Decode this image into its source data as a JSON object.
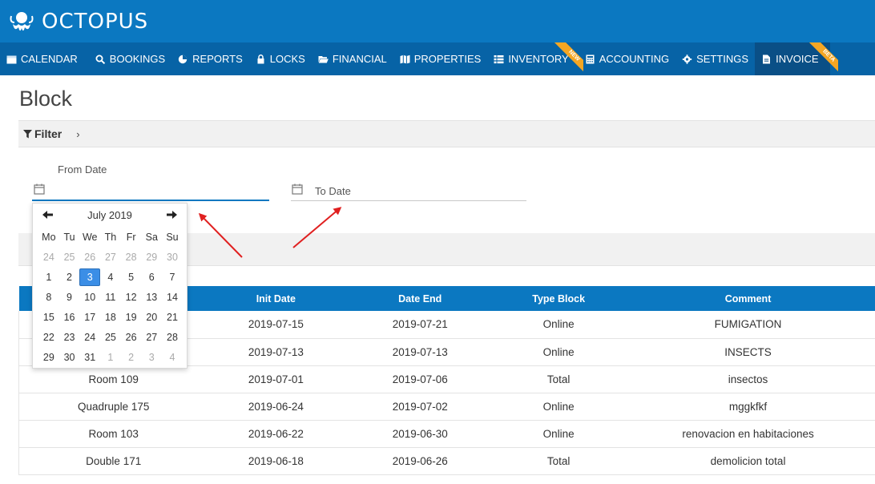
{
  "brand": {
    "name": "OCTOPUS"
  },
  "nav": {
    "items": [
      {
        "label": "CALENDAR",
        "icon": "calendar-icon"
      },
      {
        "label": "BOOKINGS",
        "icon": "search-icon"
      },
      {
        "label": "REPORTS",
        "icon": "pie-chart-icon"
      },
      {
        "label": "LOCKS",
        "icon": "lock-icon"
      },
      {
        "label": "FINANCIAL",
        "icon": "folder-open-icon"
      },
      {
        "label": "PROPERTIES",
        "icon": "map-icon"
      },
      {
        "label": "INVENTORY",
        "icon": "list-icon",
        "ribbon": "NEW"
      },
      {
        "label": "ACCOUNTING",
        "icon": "calculator-icon"
      },
      {
        "label": "SETTINGS",
        "icon": "gear-icon"
      },
      {
        "label": "INVOICE",
        "icon": "file-icon",
        "ribbon": "BETA",
        "active": true
      }
    ]
  },
  "page": {
    "title": "Block"
  },
  "filter": {
    "label": "Filter",
    "from_label": "From Date",
    "from_value": "",
    "to_placeholder": "To Date",
    "to_value": ""
  },
  "datepicker": {
    "month": "July 2019",
    "weekdays": [
      "Mo",
      "Tu",
      "We",
      "Th",
      "Fr",
      "Sa",
      "Su"
    ],
    "weeks": [
      [
        "24",
        "25",
        "26",
        "27",
        "28",
        "29",
        "30"
      ],
      [
        "1",
        "2",
        "3",
        "4",
        "5",
        "6",
        "7"
      ],
      [
        "8",
        "9",
        "10",
        "11",
        "12",
        "13",
        "14"
      ],
      [
        "15",
        "16",
        "17",
        "18",
        "19",
        "20",
        "21"
      ],
      [
        "22",
        "23",
        "24",
        "25",
        "26",
        "27",
        "28"
      ],
      [
        "29",
        "30",
        "31",
        "1",
        "2",
        "3",
        "4"
      ]
    ],
    "selected": "3"
  },
  "table": {
    "columns": [
      "",
      "Init Date",
      "Date End",
      "Type Block",
      "Comment"
    ],
    "rows": [
      [
        "",
        "2019-07-15",
        "2019-07-21",
        "Online",
        "FUMIGATION"
      ],
      [
        "",
        "2019-07-13",
        "2019-07-13",
        "Online",
        "INSECTS"
      ],
      [
        "Room 109",
        "2019-07-01",
        "2019-07-06",
        "Total",
        "insectos"
      ],
      [
        "Quadruple 175",
        "2019-06-24",
        "2019-07-02",
        "Online",
        "mggkfkf"
      ],
      [
        "Room 103",
        "2019-06-22",
        "2019-06-30",
        "Online",
        "renovacion en habitaciones"
      ],
      [
        "Double 171",
        "2019-06-18",
        "2019-06-26",
        "Total",
        "demolicion total"
      ]
    ]
  },
  "colors": {
    "header": "#0b78c1",
    "nav": "#0763a6",
    "ribbon": "#f5a623",
    "selected_day": "#3b8ee6",
    "annotation_arrow": "#e02020"
  }
}
